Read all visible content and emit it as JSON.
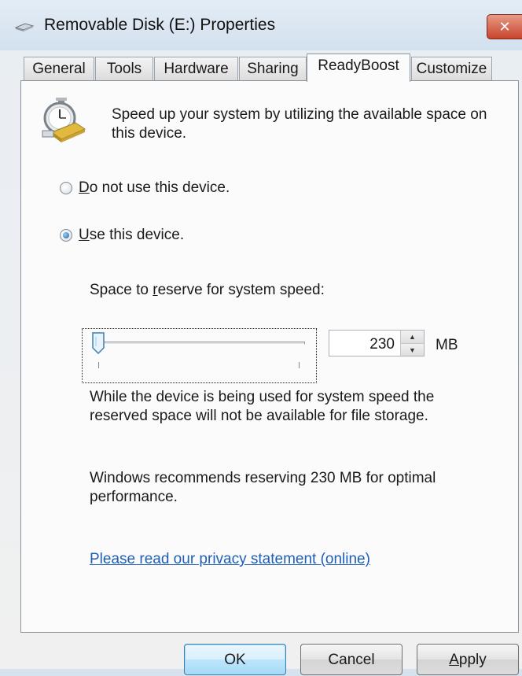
{
  "window": {
    "title": "Removable Disk (E:) Properties",
    "close_label": "✕"
  },
  "tabs": [
    {
      "label": "General",
      "active": false
    },
    {
      "label": "Tools",
      "active": false
    },
    {
      "label": "Hardware",
      "active": false
    },
    {
      "label": "Sharing",
      "active": false
    },
    {
      "label": "ReadyBoost",
      "active": true
    },
    {
      "label": "Customize",
      "active": false
    }
  ],
  "readyboost": {
    "icon": "readyboost-stopwatch-icon",
    "intro": "Speed up your system by utilizing the available space on this device.",
    "options": [
      {
        "label_underlined": "D",
        "label_rest": "o not use this device.",
        "selected": false
      },
      {
        "label_underlined": "U",
        "label_rest": "se this device.",
        "selected": true
      }
    ],
    "reserve_label_prefix": "Space to ",
    "reserve_label_underlined": "r",
    "reserve_label_suffix": "eserve for system speed:",
    "reserve_value": "230",
    "reserve_unit": "MB",
    "slider_level": 0.0,
    "storage_note": "While the device is being used for system speed the reserved space will not be available for file storage.",
    "recommendation": "Windows recommends reserving 230 MB for optimal performance.",
    "privacy_link": "Please read our privacy statement (online)"
  },
  "buttons": {
    "ok": "OK",
    "cancel": "Cancel",
    "apply_underlined": "A",
    "apply_rest": "pply"
  },
  "colors": {
    "link": "#1f5fb5",
    "default_button_border": "#3c7fb1",
    "close_button": "#c8452c"
  }
}
